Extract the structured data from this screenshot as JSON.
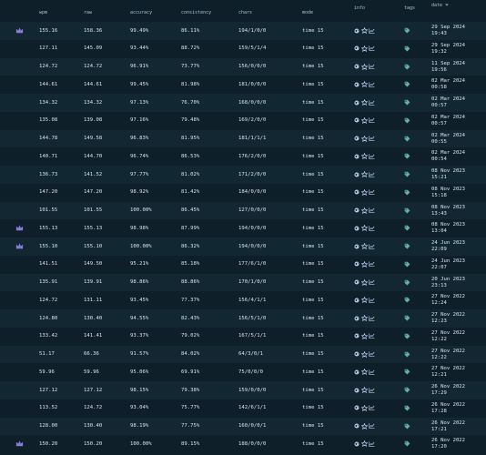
{
  "header": {
    "wpm": "wpm",
    "raw": "raw",
    "accuracy": "accuracy",
    "consistency": "consistency",
    "chars": "chars",
    "mode": "mode",
    "info": "info",
    "tags": "tags",
    "date": "date ⏷"
  },
  "colors": {
    "background": "#0f1f2a",
    "row_alt": "#132733",
    "crown": "#8a7bd6",
    "icon": "#b7c8ea",
    "tag": "#5fb3a3"
  },
  "icons": {
    "crown": "crown-icon",
    "info": [
      "globe-icon",
      "star-icon",
      "chart-icon"
    ],
    "tag": "tag-icon"
  },
  "rows": [
    {
      "pb": true,
      "wpm": "155.16",
      "raw": "158.36",
      "acc": "99.49%",
      "con": "86.11%",
      "chars": "194/1/0/0",
      "mode": "time 15",
      "date1": "29 Sep 2024",
      "date2": "19:43"
    },
    {
      "pb": false,
      "wpm": "127.11",
      "raw": "145.09",
      "acc": "93.44%",
      "con": "88.72%",
      "chars": "159/5/1/4",
      "mode": "time 15",
      "date1": "29 Sep 2024",
      "date2": "19:32"
    },
    {
      "pb": false,
      "wpm": "124.72",
      "raw": "124.72",
      "acc": "96.91%",
      "con": "73.77%",
      "chars": "156/0/0/0",
      "mode": "time 15",
      "date1": "11 Sep 2024",
      "date2": "19:56"
    },
    {
      "pb": false,
      "wpm": "144.61",
      "raw": "144.61",
      "acc": "99.45%",
      "con": "81.98%",
      "chars": "181/0/0/0",
      "mode": "time 15",
      "date1": "02 Mar 2024",
      "date2": "00:58"
    },
    {
      "pb": false,
      "wpm": "134.32",
      "raw": "134.32",
      "acc": "97.13%",
      "con": "76.70%",
      "chars": "168/0/0/0",
      "mode": "time 15",
      "date1": "02 Mar 2024",
      "date2": "00:57"
    },
    {
      "pb": false,
      "wpm": "135.08",
      "raw": "139.08",
      "acc": "97.16%",
      "con": "79.48%",
      "chars": "169/2/0/0",
      "mode": "time 15",
      "date1": "02 Mar 2024",
      "date2": "00:57"
    },
    {
      "pb": false,
      "wpm": "144.78",
      "raw": "149.58",
      "acc": "96.83%",
      "con": "81.95%",
      "chars": "181/1/1/1",
      "mode": "time 15",
      "date1": "02 Mar 2024",
      "date2": "00:55"
    },
    {
      "pb": false,
      "wpm": "140.71",
      "raw": "144.70",
      "acc": "96.74%",
      "con": "86.53%",
      "chars": "176/2/0/0",
      "mode": "time 15",
      "date1": "02 Mar 2024",
      "date2": "00:54"
    },
    {
      "pb": false,
      "wpm": "136.73",
      "raw": "141.52",
      "acc": "97.77%",
      "con": "81.02%",
      "chars": "171/2/0/0",
      "mode": "time 15",
      "date1": "08 Nov 2023",
      "date2": "15:21"
    },
    {
      "pb": false,
      "wpm": "147.20",
      "raw": "147.20",
      "acc": "98.92%",
      "con": "81.42%",
      "chars": "184/0/0/0",
      "mode": "time 15",
      "date1": "08 Nov 2023",
      "date2": "15:18"
    },
    {
      "pb": false,
      "wpm": "101.55",
      "raw": "101.55",
      "acc": "100.00%",
      "con": "86.45%",
      "chars": "127/0/0/0",
      "mode": "time 15",
      "date1": "08 Nov 2023",
      "date2": "13:43"
    },
    {
      "pb": true,
      "wpm": "155.13",
      "raw": "155.13",
      "acc": "98.98%",
      "con": "87.99%",
      "chars": "194/0/0/0",
      "mode": "time 15",
      "date1": "08 Nov 2023",
      "date2": "13:04"
    },
    {
      "pb": true,
      "wpm": "155.10",
      "raw": "155.10",
      "acc": "100.00%",
      "con": "86.32%",
      "chars": "194/0/0/0",
      "mode": "time 15",
      "date1": "24 Jun 2023",
      "date2": "22:09"
    },
    {
      "pb": false,
      "wpm": "141.51",
      "raw": "149.50",
      "acc": "95.21%",
      "con": "85.18%",
      "chars": "177/6/1/0",
      "mode": "time 15",
      "date1": "24 Jun 2023",
      "date2": "22:07"
    },
    {
      "pb": false,
      "wpm": "135.91",
      "raw": "139.91",
      "acc": "98.86%",
      "con": "88.86%",
      "chars": "170/1/0/0",
      "mode": "time 15",
      "date1": "20 Jun 2023",
      "date2": "23:13"
    },
    {
      "pb": false,
      "wpm": "124.72",
      "raw": "131.11",
      "acc": "93.45%",
      "con": "77.37%",
      "chars": "156/4/1/1",
      "mode": "time 15",
      "date1": "27 Nov 2022",
      "date2": "12:24"
    },
    {
      "pb": false,
      "wpm": "124.80",
      "raw": "130.40",
      "acc": "94.55%",
      "con": "82.43%",
      "chars": "156/5/1/0",
      "mode": "time 15",
      "date1": "27 Nov 2022",
      "date2": "12:23"
    },
    {
      "pb": false,
      "wpm": "133.42",
      "raw": "141.41",
      "acc": "93.37%",
      "con": "79.02%",
      "chars": "167/5/1/1",
      "mode": "time 15",
      "date1": "27 Nov 2022",
      "date2": "12:22"
    },
    {
      "pb": false,
      "wpm": "51.17",
      "raw": "66.36",
      "acc": "91.57%",
      "con": "84.02%",
      "chars": "64/3/0/1",
      "mode": "time 15",
      "date1": "27 Nov 2022",
      "date2": "12:22"
    },
    {
      "pb": false,
      "wpm": "59.96",
      "raw": "59.96",
      "acc": "95.06%",
      "con": "69.91%",
      "chars": "75/0/0/0",
      "mode": "time 15",
      "date1": "27 Nov 2022",
      "date2": "12:21"
    },
    {
      "pb": false,
      "wpm": "127.12",
      "raw": "127.12",
      "acc": "98.15%",
      "con": "79.38%",
      "chars": "159/0/0/0",
      "mode": "time 15",
      "date1": "26 Nov 2022",
      "date2": "17:29"
    },
    {
      "pb": false,
      "wpm": "113.52",
      "raw": "124.72",
      "acc": "93.04%",
      "con": "75.77%",
      "chars": "142/6/1/1",
      "mode": "time 15",
      "date1": "26 Nov 2022",
      "date2": "17:28"
    },
    {
      "pb": false,
      "wpm": "128.00",
      "raw": "130.40",
      "acc": "98.19%",
      "con": "77.75%",
      "chars": "160/0/0/1",
      "mode": "time 15",
      "date1": "26 Nov 2022",
      "date2": "17:21"
    },
    {
      "pb": true,
      "wpm": "150.20",
      "raw": "150.20",
      "acc": "100.00%",
      "con": "89.15%",
      "chars": "188/0/0/0",
      "mode": "time 15",
      "date1": "26 Nov 2022",
      "date2": "17:20"
    }
  ]
}
